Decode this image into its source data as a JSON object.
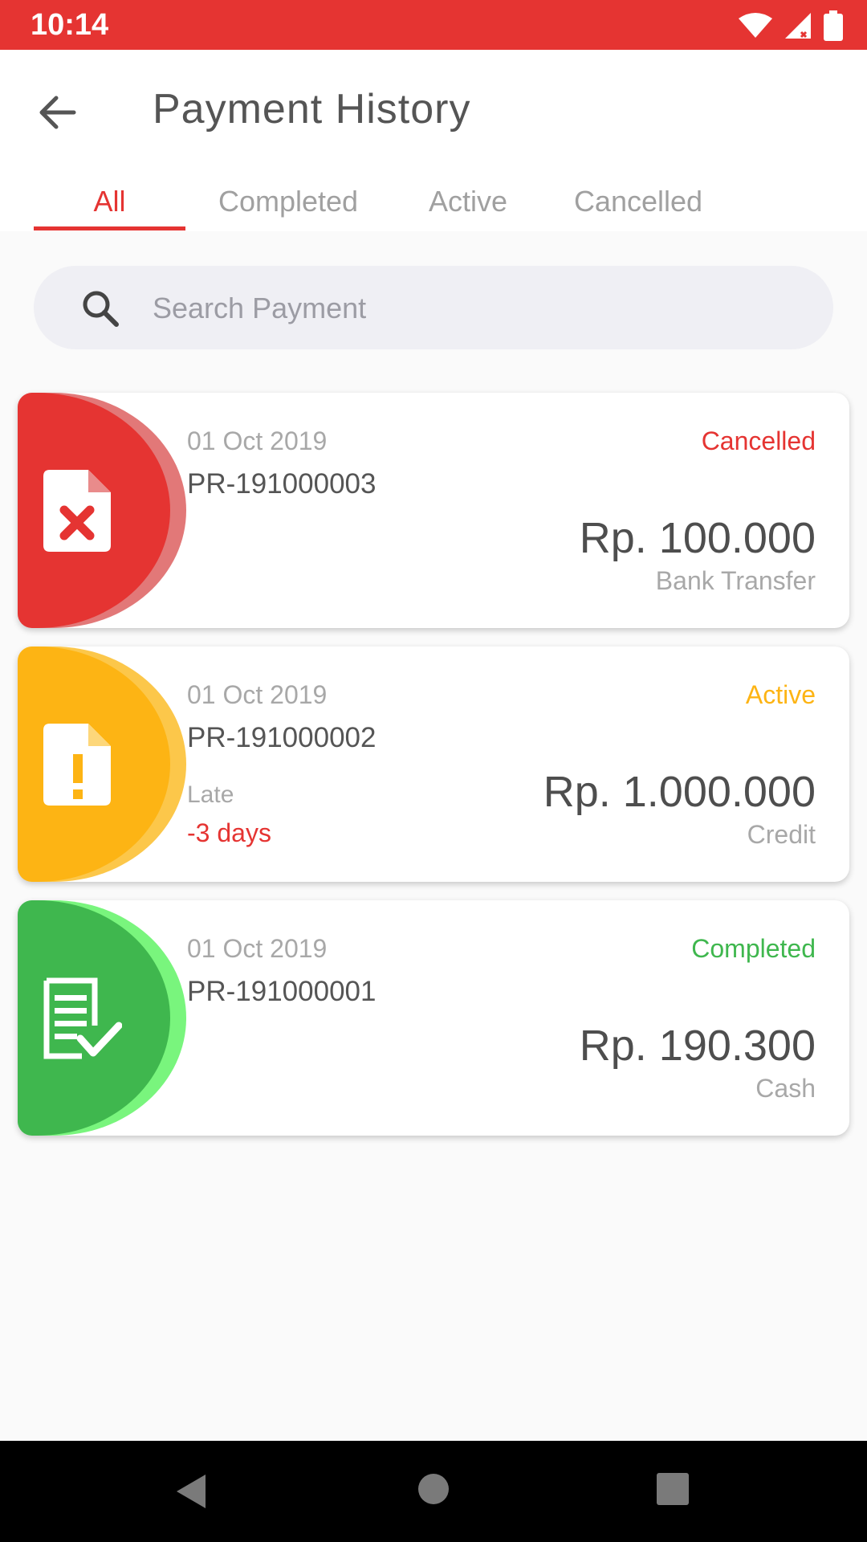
{
  "status_bar": {
    "time": "10:14"
  },
  "app_bar": {
    "title": "Payment History"
  },
  "tabs": [
    {
      "label": "All"
    },
    {
      "label": "Completed"
    },
    {
      "label": "Active"
    },
    {
      "label": "Cancelled"
    }
  ],
  "search": {
    "placeholder": "Search Payment"
  },
  "payments": [
    {
      "date": "01 Oct 2019",
      "ref": "PR-191000003",
      "status": "Cancelled",
      "amount": "Rp. 100.000",
      "method": "Bank Transfer",
      "color": "#e53432",
      "icon": "document-cancel-icon"
    },
    {
      "date": "01 Oct 2019",
      "ref": "PR-191000002",
      "status": "Active",
      "amount": "Rp. 1.000.000",
      "method": "Credit",
      "late_label": "Late",
      "late_days": "-3 days",
      "color": "#fdb414",
      "icon": "document-alert-icon"
    },
    {
      "date": "01 Oct 2019",
      "ref": "PR-191000001",
      "status": "Completed",
      "amount": "Rp. 190.300",
      "method": "Cash",
      "color": "#3fb74e",
      "icon": "document-check-icon"
    }
  ],
  "colors": {
    "accent": "#e53432",
    "cancelled": "#e53432",
    "active": "#fdb414",
    "completed": "#3fb74e"
  }
}
